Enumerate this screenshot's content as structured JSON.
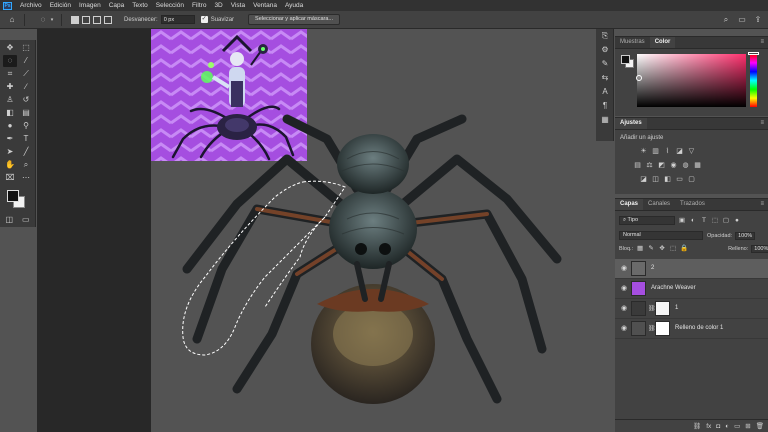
{
  "menu": [
    "Archivo",
    "Edición",
    "Imagen",
    "Capa",
    "Texto",
    "Selección",
    "Filtro",
    "3D",
    "Vista",
    "Ventana",
    "Ayuda"
  ],
  "app": {
    "logo": "Ps"
  },
  "options": {
    "feather_label": "Desvanecer:",
    "feather_value": "0 px",
    "antialias_label": "Suavizar",
    "antialias_checked": true,
    "select_mask_button": "Seleccionar y aplicar máscara..."
  },
  "toolbar": {
    "tools": [
      "move-tool-icon",
      "marquee-tool-icon",
      "lasso-tool-icon",
      "magic-wand-tool-icon",
      "crop-tool-icon",
      "eyedropper-tool-icon",
      "healing-brush-icon",
      "brush-tool-icon",
      "clone-stamp-icon",
      "history-brush-icon",
      "eraser-tool-icon",
      "gradient-tool-icon",
      "blur-tool-icon",
      "dodge-tool-icon",
      "pen-tool-icon",
      "type-tool-icon",
      "path-selection-icon",
      "line-tool-icon",
      "hand-tool-icon",
      "zoom-tool-icon",
      "edit-toolbar-icon",
      "more-tools-icon"
    ],
    "active_tool": "lasso-tool-icon",
    "foreground": "#111111",
    "background": "#f2f2f2"
  },
  "panels": {
    "color_tabs": [
      "Muestras",
      "Color"
    ],
    "color_active": "Color",
    "adjust_tab": "Ajustes",
    "adjust_title": "Añadir un ajuste",
    "layers_tabs": [
      "Capas",
      "Canales",
      "Trazados"
    ],
    "layers_active": "Capas",
    "filter_label": "Tipo",
    "blend_mode": "Normal",
    "opacity_label": "Opacidad:",
    "opacity_value": "100%",
    "lock_label": "Bloq.:",
    "fill_label": "Relleno:",
    "fill_value": "100%"
  },
  "layers": [
    {
      "name": "2",
      "selected": true,
      "visible": true,
      "type": "smart-object"
    },
    {
      "name": "Arachne Weaver",
      "selected": false,
      "visible": true,
      "type": "image"
    },
    {
      "name": "1",
      "selected": false,
      "visible": true,
      "type": "masked"
    },
    {
      "name": "Relleno de color 1",
      "selected": false,
      "visible": true,
      "type": "fill"
    }
  ],
  "colors": {
    "accent": "#31a8ff",
    "canvas_bg": "#535353",
    "thumbnail_purple": "#a54ee0"
  }
}
